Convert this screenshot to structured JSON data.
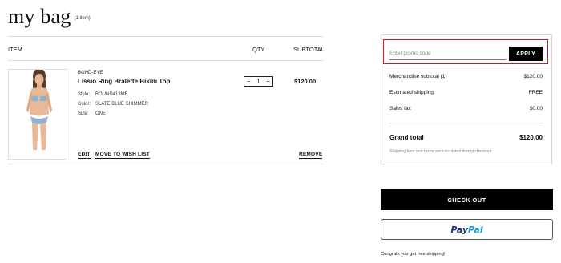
{
  "header": {
    "title": "my bag",
    "count": "(1 item)"
  },
  "columns": {
    "item": "ITEM",
    "qty": "QTY",
    "subtotal": "SUBTOTAL"
  },
  "cart_item": {
    "brand": "BOND-EYE",
    "name": "Lissio Ring Bralette Bikini Top",
    "attributes": [
      {
        "label": "Style:",
        "value": "BOUND413ME"
      },
      {
        "label": "Color:",
        "value": "SLATE BLUE SHIMMER"
      },
      {
        "label": "Size:",
        "value": "ONE"
      }
    ],
    "quantity": "1",
    "qty_minus": "−",
    "qty_plus": "+",
    "price": "$120.00",
    "actions": {
      "edit": "EDIT",
      "wishlist": "MOVE TO WISH LIST",
      "remove": "REMOVE"
    }
  },
  "summary": {
    "promo_placeholder": "Enter promo code",
    "apply_label": "APPLY",
    "rows": [
      {
        "label": "Merchandise subtotal (1)",
        "value": "$120.00"
      },
      {
        "label": "Estimated shipping",
        "value": "FREE"
      },
      {
        "label": "Sales tax",
        "value": "$0.00"
      }
    ],
    "grand_total": {
      "label": "Grand total",
      "value": "$120.00"
    },
    "note": "Shipping fees and taxes are calculated during checkout."
  },
  "checkout": {
    "label": "CHECK OUT"
  },
  "paypal": {
    "pay": "Pay",
    "pal": "Pal"
  },
  "shipping_message": "Congrats you get free shipping!",
  "colors": {
    "promo_highlight": "#e0141e",
    "paypal_dark": "#253b80",
    "paypal_light": "#179bd7",
    "swimsuit": "#8fb0cf"
  }
}
